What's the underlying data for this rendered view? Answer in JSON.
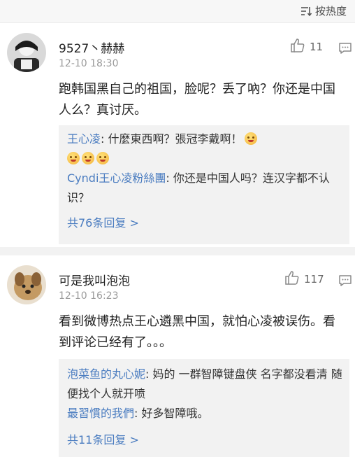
{
  "header": {
    "sort_label": "按热度"
  },
  "comments": [
    {
      "username": "9527丶赫赫",
      "time": "12-10 18:30",
      "likes": "11",
      "text": "跑韩国黑自己的祖国，脸呢？丢了吶？你还是中国人么？真讨厌。",
      "replies": [
        {
          "name": "王心凌",
          "text": ": 什麼東西啊？張冠李戴啊！"
        },
        {
          "name": "Cyndi王心凌粉絲團",
          "text": ": 你还是中国人吗？连汉字都不认识？"
        }
      ],
      "more": "共76条回复 >"
    },
    {
      "username": "可是我叫泡泡",
      "time": "12-10 16:23",
      "likes": "117",
      "text": "看到微博热点王心遴黑中国，就怕心凌被误伤。看到评论已经有了。。。",
      "replies": [
        {
          "name": "泡菜鱼的丸心妮",
          "text": ": 妈的 一群智障键盘侠 名字都没看清 随便找个人就开喷"
        },
        {
          "name": "最習慣的我們",
          "text": ": 好多智障哦。"
        }
      ],
      "more": "共11条回复 >"
    }
  ],
  "icons": {
    "sort": "sort-icon",
    "like": "thumbs-up-icon",
    "reply": "comment-icon",
    "emoji": "face-emoji-icon"
  }
}
